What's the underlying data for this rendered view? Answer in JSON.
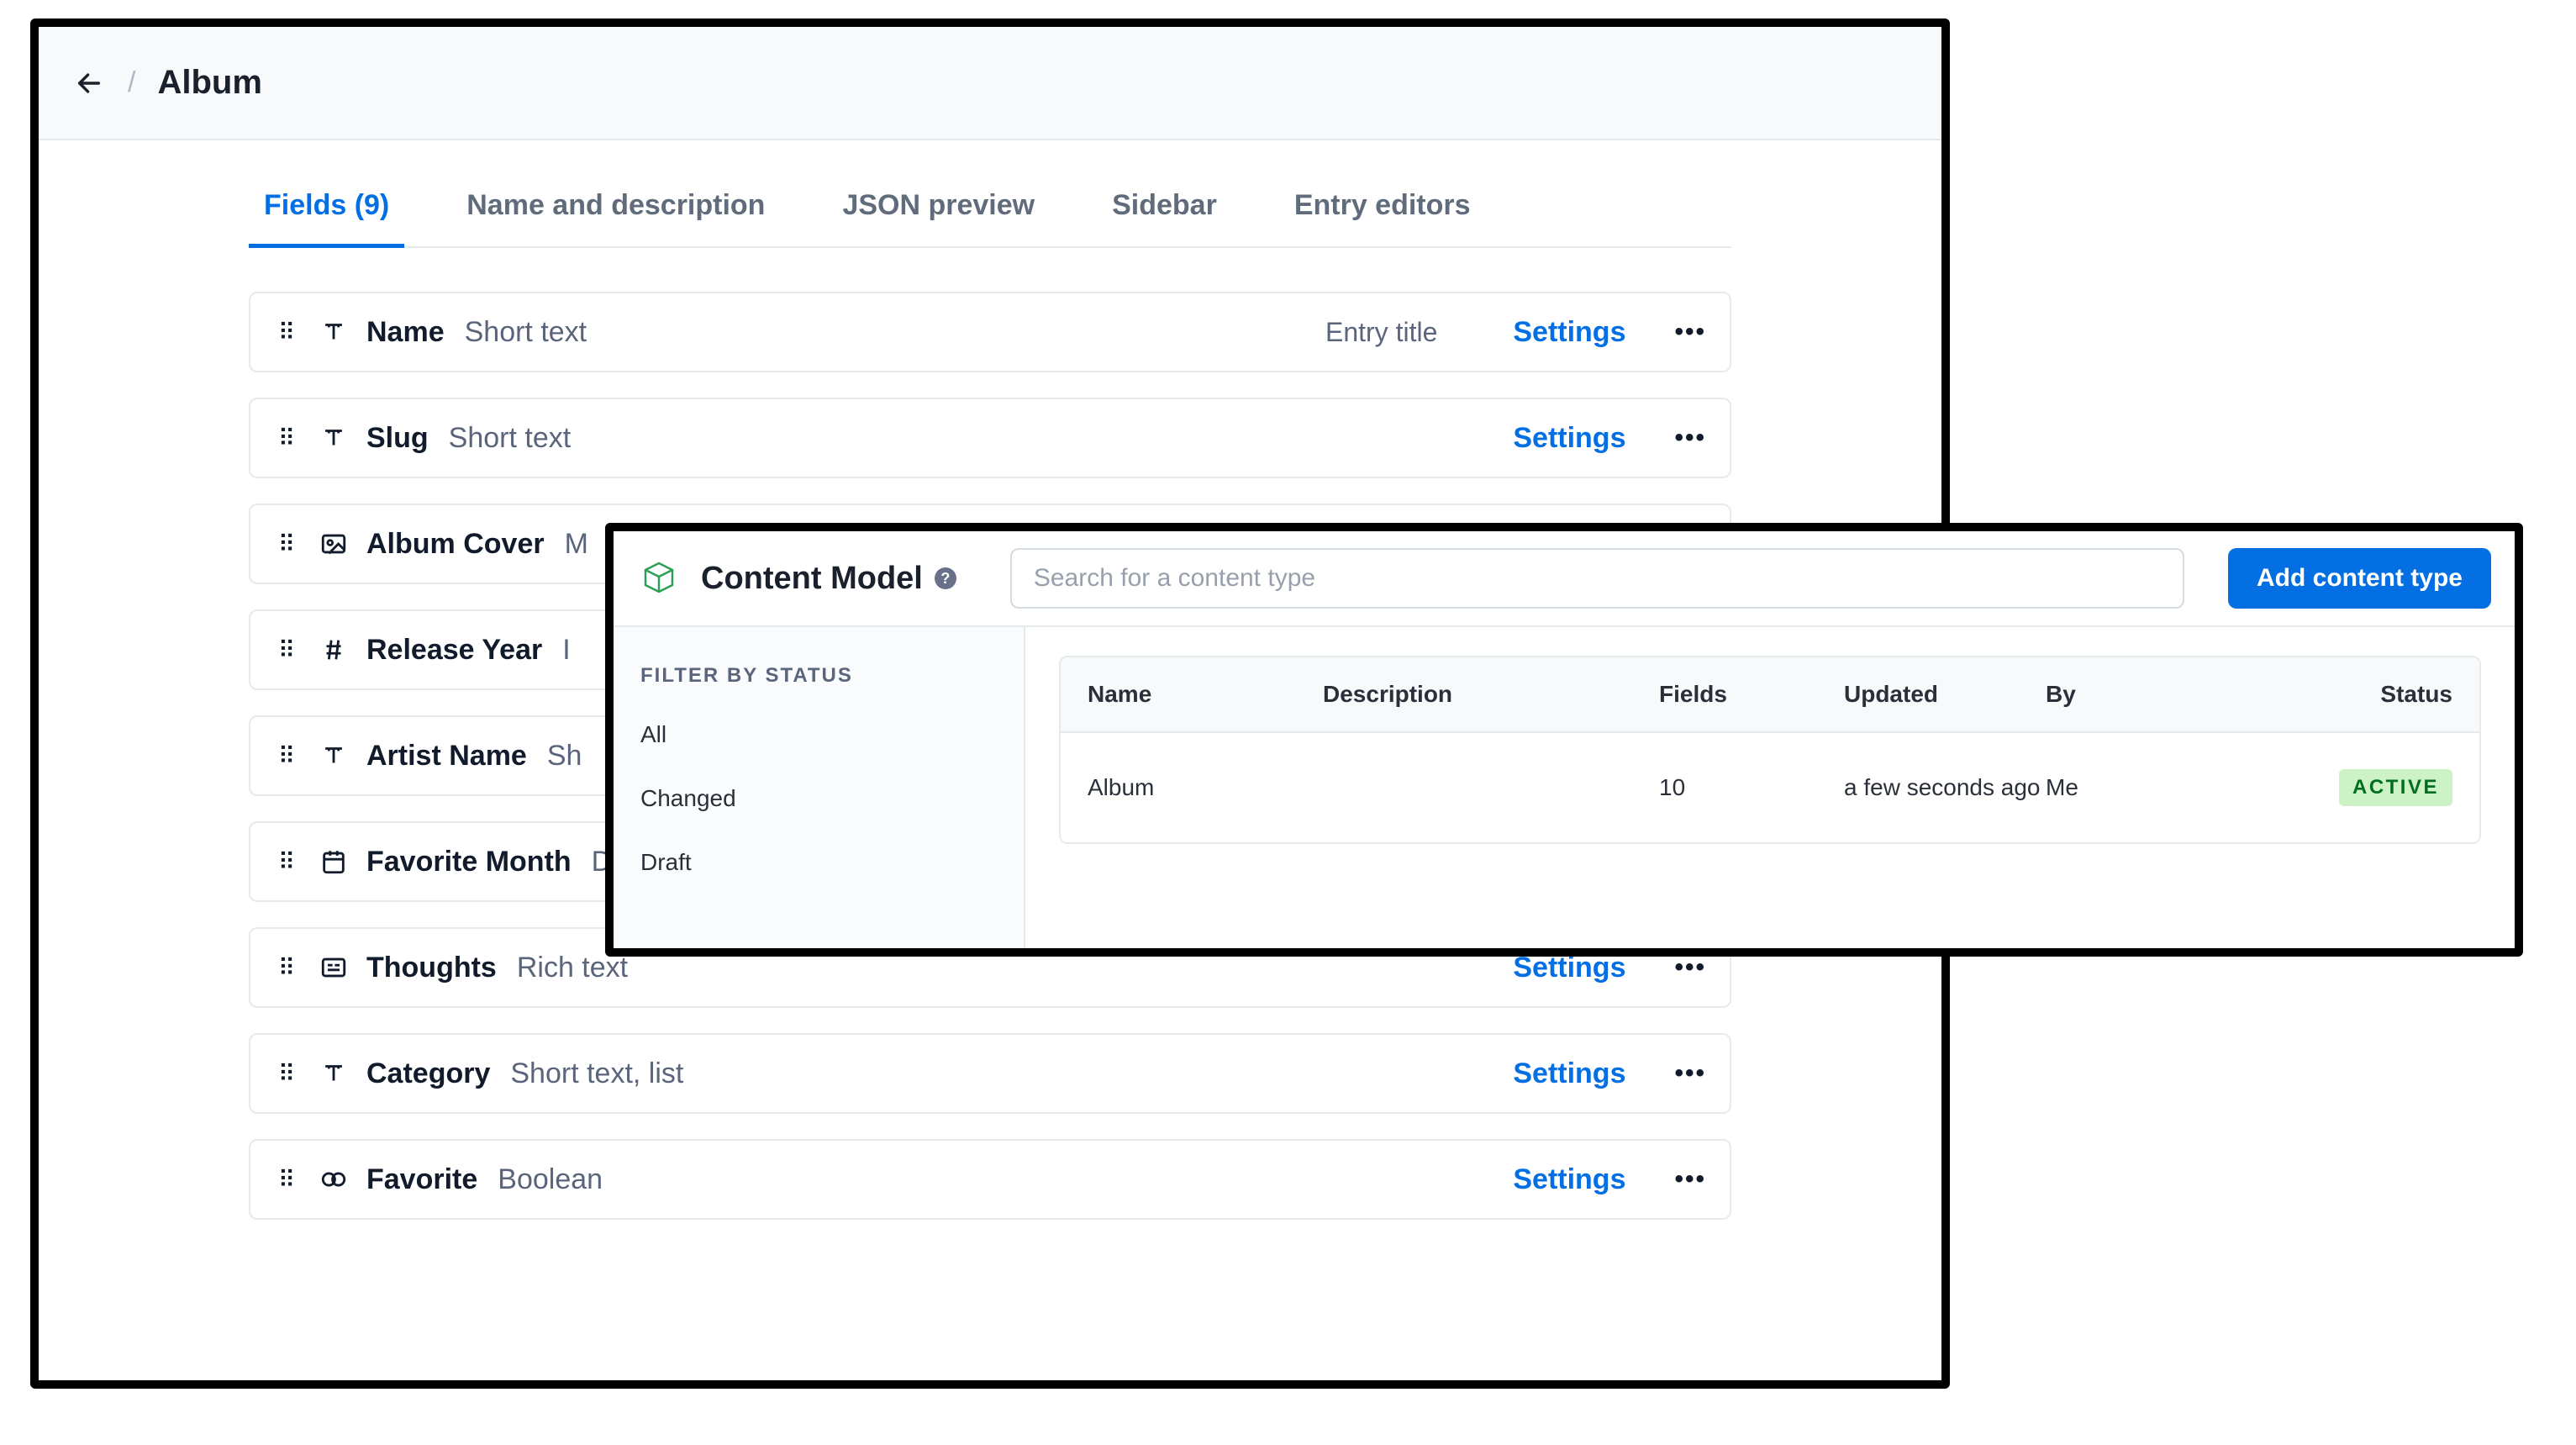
{
  "header": {
    "page_title": "Album"
  },
  "tabs": [
    {
      "label": "Fields (9)",
      "active": true
    },
    {
      "label": "Name and description",
      "active": false
    },
    {
      "label": "JSON preview",
      "active": false
    },
    {
      "label": "Sidebar",
      "active": false
    },
    {
      "label": "Entry editors",
      "active": false
    }
  ],
  "settings_label": "Settings",
  "fields": [
    {
      "icon": "text",
      "name": "Name",
      "type": "Short text",
      "badge": "Entry title"
    },
    {
      "icon": "text",
      "name": "Slug",
      "type": "Short text",
      "badge": ""
    },
    {
      "icon": "media",
      "name": "Album Cover",
      "type": "M",
      "badge": ""
    },
    {
      "icon": "number",
      "name": "Release Year",
      "type": "I",
      "badge": ""
    },
    {
      "icon": "text",
      "name": "Artist Name",
      "type": "Sh",
      "badge": ""
    },
    {
      "icon": "calendar",
      "name": "Favorite Month",
      "type": "Date & time",
      "badge": ""
    },
    {
      "icon": "richtext",
      "name": "Thoughts",
      "type": "Rich text",
      "badge": ""
    },
    {
      "icon": "text",
      "name": "Category",
      "type": "Short text, list",
      "badge": ""
    },
    {
      "icon": "boolean",
      "name": "Favorite",
      "type": "Boolean",
      "badge": ""
    }
  ],
  "overlay": {
    "title": "Content Model",
    "search_placeholder": "Search for a content type",
    "add_button": "Add content type",
    "filter_heading": "FILTER BY STATUS",
    "filters": [
      "All",
      "Changed",
      "Draft"
    ],
    "columns": {
      "name": "Name",
      "description": "Description",
      "fields": "Fields",
      "updated": "Updated",
      "by": "By",
      "status": "Status"
    },
    "rows": [
      {
        "name": "Album",
        "description": "",
        "fields": "10",
        "updated": "a few seconds ago",
        "by": "Me",
        "status": "ACTIVE"
      }
    ]
  }
}
